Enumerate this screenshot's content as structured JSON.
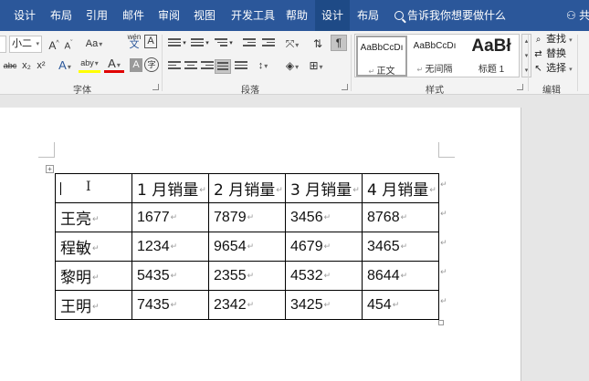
{
  "tabs": [
    {
      "label": "设计",
      "contextual": false
    },
    {
      "label": "布局",
      "contextual": false
    },
    {
      "label": "引用",
      "contextual": false
    },
    {
      "label": "邮件",
      "contextual": false
    },
    {
      "label": "审阅",
      "contextual": false
    },
    {
      "label": "视图",
      "contextual": false
    },
    {
      "label": "开发工具",
      "contextual": false
    },
    {
      "label": "帮助",
      "contextual": false
    },
    {
      "label": "设计",
      "contextual": true
    },
    {
      "label": "布局",
      "contextual": false
    }
  ],
  "tell_me": "告诉我你想要做什么",
  "share_label": "共享",
  "font_group": {
    "label": "字体",
    "font_size": "小二",
    "grow_font": "A",
    "shrink_font": "A",
    "change_case": "Aa",
    "phonetic": "wén",
    "char_border": "A",
    "strike": "abc",
    "subscript": "x₂",
    "superscript": "x²",
    "text_effect": "A",
    "highlight": "aby",
    "font_color": "A",
    "char_shading": "A",
    "enclose": "字"
  },
  "paragraph_group": {
    "label": "段落"
  },
  "styles_group": {
    "label": "样式",
    "items": [
      {
        "sample": "AaBbCcDı",
        "name": "正文"
      },
      {
        "sample": "AaBbCcDı",
        "name": "无间隔"
      },
      {
        "sample": "AaBł",
        "name": "标题 1"
      }
    ]
  },
  "editing_group": {
    "label": "编辑",
    "find": "查找",
    "replace": "替换",
    "select": "选择"
  },
  "table": {
    "header": [
      "",
      "1 月销量",
      "2 月销量",
      "3 月销量",
      "4 月销量"
    ],
    "rows": [
      [
        "王亮",
        "1677",
        "7879",
        "3456",
        "8768"
      ],
      [
        "程敏",
        "1234",
        "9654",
        "4679",
        "3465"
      ],
      [
        "黎明",
        "5435",
        "2355",
        "4532",
        "8644"
      ],
      [
        "王明",
        "7435",
        "2342",
        "3425",
        "454"
      ]
    ]
  },
  "marks": {
    "cell_end": "↵",
    "table_move": "+",
    "ibeam": "I"
  }
}
